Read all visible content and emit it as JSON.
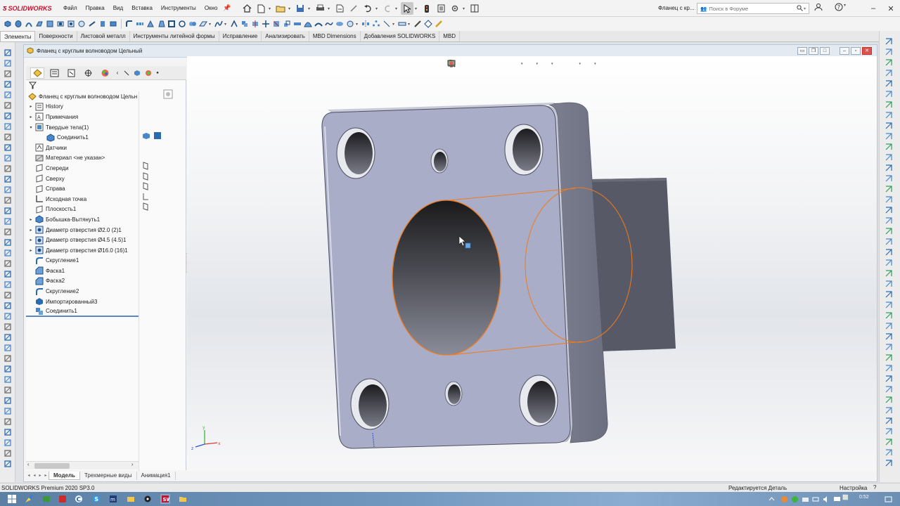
{
  "app": {
    "logo_text": "SOLIDWORKS",
    "menu": [
      "Файл",
      "Правка",
      "Вид",
      "Вставка",
      "Инструменты",
      "Окно"
    ],
    "doc_title_short": "Фланец с кр...",
    "search_placeholder": "Поиск в Форуме"
  },
  "tabs": [
    "Элементы",
    "Поверхности",
    "Листовой металл",
    "Инструменты литейной формы",
    "Исправление",
    "Анализировать",
    "MBD Dimensions",
    "Добавления SOLIDWORKS",
    "MBD"
  ],
  "active_tab": "Элементы",
  "document": {
    "title": "Фланец с круглым волноводом Цельный"
  },
  "tree": {
    "root": "Фланец с круглым волноводом Цельн",
    "items": [
      {
        "label": "History",
        "icon": "history-icon",
        "arrow": "▸",
        "indent": 0
      },
      {
        "label": "Примечания",
        "icon": "annotations-icon",
        "arrow": "▸",
        "indent": 0
      },
      {
        "label": "Твердые тела(1)",
        "icon": "solid-bodies-icon",
        "arrow": "▾",
        "indent": 0
      },
      {
        "label": "Соединить1",
        "icon": "body-icon",
        "arrow": "",
        "indent": 1
      },
      {
        "label": "Датчики",
        "icon": "sensors-icon",
        "arrow": "",
        "indent": 0
      },
      {
        "label": "Материал <не указан>",
        "icon": "material-icon",
        "arrow": "",
        "indent": 0
      },
      {
        "label": "Спереди",
        "icon": "plane-icon",
        "arrow": "",
        "indent": 0
      },
      {
        "label": "Сверху",
        "icon": "plane-icon",
        "arrow": "",
        "indent": 0
      },
      {
        "label": "Справа",
        "icon": "plane-icon",
        "arrow": "",
        "indent": 0
      },
      {
        "label": "Исходная точка",
        "icon": "origin-icon",
        "arrow": "",
        "indent": 0
      },
      {
        "label": "Плоскость1",
        "icon": "plane-icon",
        "arrow": "",
        "indent": 0
      },
      {
        "label": "Бобышка-Вытянуть1",
        "icon": "boss-extrude-icon",
        "arrow": "▸",
        "indent": 0
      },
      {
        "label": "Диаметр отверстия Ø2.0 (2)1",
        "icon": "hole-icon",
        "arrow": "▸",
        "indent": 0
      },
      {
        "label": "Диаметр отверстия Ø4.5 (4.5)1",
        "icon": "hole-icon",
        "arrow": "▸",
        "indent": 0
      },
      {
        "label": "Диаметр отверстия Ø16.0 (16)1",
        "icon": "hole-icon",
        "arrow": "▸",
        "indent": 0
      },
      {
        "label": "Скругление1",
        "icon": "fillet-icon",
        "arrow": "",
        "indent": 0
      },
      {
        "label": "Фаска1",
        "icon": "chamfer-icon",
        "arrow": "",
        "indent": 0
      },
      {
        "label": "Фаска2",
        "icon": "chamfer-icon",
        "arrow": "",
        "indent": 0
      },
      {
        "label": "Скругление2",
        "icon": "fillet-icon",
        "arrow": "",
        "indent": 0
      },
      {
        "label": "Импортированный3",
        "icon": "imported-icon",
        "arrow": "",
        "indent": 0
      },
      {
        "label": "Соединить1",
        "icon": "combine-icon",
        "arrow": "",
        "indent": 0
      }
    ]
  },
  "bottom_tabs": [
    "Модель",
    "Трехмерные виды",
    "Анимация1"
  ],
  "active_bottom_tab": "Модель",
  "status": {
    "product": "SOLIDWORKS Premium 2020 SP3.0",
    "editing": "Редактируется Деталь",
    "settings": "Настройка",
    "help": "?"
  },
  "taskbar": {
    "clock": "0:52"
  },
  "colors": {
    "brand": "#c8102e",
    "part_face": "#a9adc8",
    "selection": "#f07a1a"
  }
}
